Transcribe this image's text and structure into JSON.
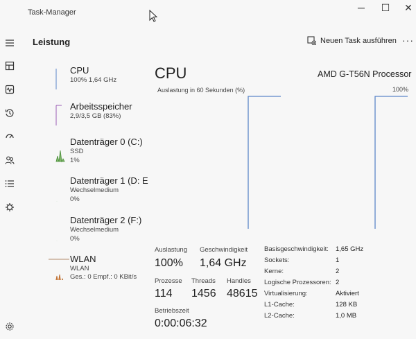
{
  "window": {
    "title": "Task-Manager",
    "minimize": "─",
    "maximize": "☐",
    "close": "✕"
  },
  "header": {
    "section_title": "Leistung",
    "new_task_label": "Neuen Task ausführen",
    "more": "···"
  },
  "nav": [
    {
      "name": "menu-icon",
      "glyph": "≡"
    },
    {
      "name": "processes-icon",
      "glyph": "▦"
    },
    {
      "name": "performance-icon",
      "glyph": "∿"
    },
    {
      "name": "history-icon",
      "glyph": "↺"
    },
    {
      "name": "startup-icon",
      "glyph": "⌁"
    },
    {
      "name": "users-icon",
      "glyph": "☺"
    },
    {
      "name": "details-icon",
      "glyph": "☰"
    },
    {
      "name": "services-icon",
      "glyph": "⚙"
    },
    {
      "name": "settings-icon",
      "glyph": "⚙"
    }
  ],
  "sidebar": [
    {
      "name": "CPU",
      "sub1": "100% 1,64 GHz",
      "sub2": "",
      "sub3": ""
    },
    {
      "name": "Arbeitsspeicher",
      "sub1": "2,9/3,5 GB (83%)",
      "sub2": "",
      "sub3": ""
    },
    {
      "name": "Datenträger 0 (C:)",
      "sub1": "SSD",
      "sub2": "1%",
      "sub3": ""
    },
    {
      "name": "Datenträger 1 (D: E",
      "sub1": "Wechselmedium",
      "sub2": "0%",
      "sub3": ""
    },
    {
      "name": "Datenträger 2 (F:)",
      "sub1": "Wechselmedium",
      "sub2": "0%",
      "sub3": ""
    },
    {
      "name": "WLAN",
      "sub1": "WLAN",
      "sub2": "Ges.: 0 Empf.: 0 KBit/s",
      "sub3": ""
    }
  ],
  "main": {
    "title": "CPU",
    "model": "AMD G-T56N Processor",
    "graph_label": "Auslastung in 60 Sekunden (%)",
    "graph_max": "100%",
    "graph_color": "#5b86c8",
    "stats": {
      "util_label": "Auslastung",
      "util_value": "100%",
      "speed_label": "Geschwindigkeit",
      "speed_value": "1,64 GHz",
      "proc_label": "Prozesse",
      "proc_value": "114",
      "threads_label": "Threads",
      "threads_value": "1456",
      "handles_label": "Handles",
      "handles_value": "48615",
      "uptime_label": "Betriebszeit",
      "uptime_value": "0:00:06:32"
    },
    "info": [
      {
        "label": "Basisgeschwindigkeit:",
        "value": "1,65 GHz"
      },
      {
        "label": "Sockets:",
        "value": "1"
      },
      {
        "label": "Kerne:",
        "value": "2"
      },
      {
        "label": "Logische Prozessoren:",
        "value": "2"
      },
      {
        "label": "Virtualisierung:",
        "value": "Aktiviert"
      },
      {
        "label": "L1-Cache:",
        "value": "128 KB"
      },
      {
        "label": "L2-Cache:",
        "value": "1,0 MB"
      }
    ]
  }
}
